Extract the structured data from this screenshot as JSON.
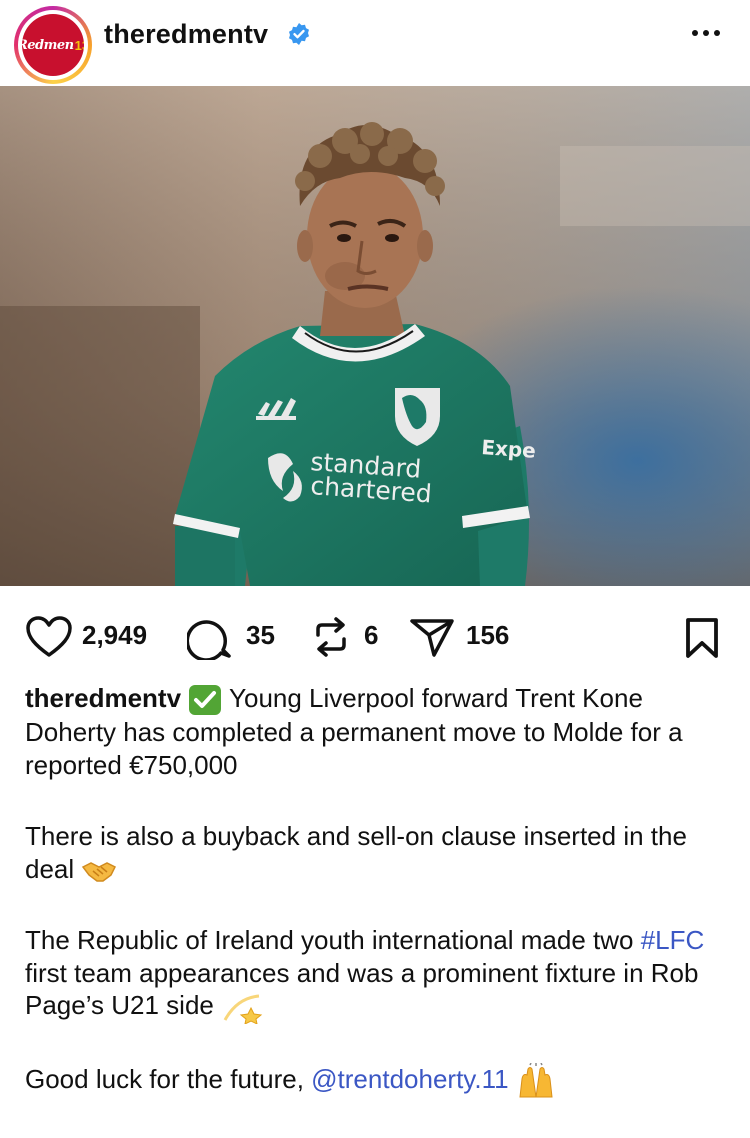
{
  "post": {
    "username": "theredmentv",
    "avatar_text": "Redmen",
    "avatar_num": "13",
    "verified_icon": "verified-badge-icon",
    "menu_icon": "more-options-icon"
  },
  "photo": {
    "sponsor_line1": "standard",
    "sponsor_line2": "chartered",
    "sleeve_text": "Expe"
  },
  "actions": {
    "likes": "2,949",
    "comments": "35",
    "reposts": "6",
    "shares": "156",
    "icons": [
      "heart-icon",
      "comment-icon",
      "repost-icon",
      "share-icon",
      "bookmark-icon"
    ]
  },
  "caption": {
    "username": "theredmentv",
    "para1": " Young Liverpool forward Trent Kone Doherty has completed a permanent move to Molde for a reported €750,000",
    "para2": "There is also a buyback and sell-on clause inserted in the deal ",
    "para3_a": "The Republic of Ireland youth international made two ",
    "hashtag": "#LFC",
    "para3_b": " first team appearances and was a prominent fixture in Rob Page’s U21 side ",
    "para4": "Good luck for the future, ",
    "mention": "@trentdoherty.11"
  },
  "colors": {
    "link": "#3b57c4",
    "verified": "#3897f0",
    "jersey": "#1e7a68",
    "check_emoji": "#52a535"
  }
}
